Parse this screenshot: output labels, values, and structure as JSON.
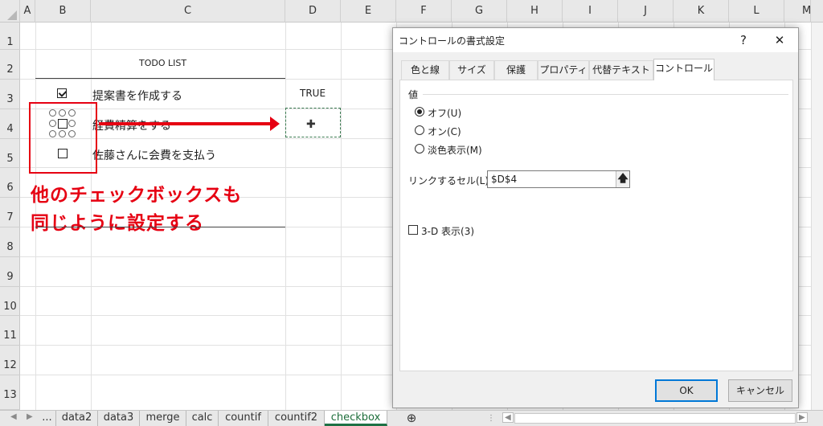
{
  "sheet": {
    "columns": [
      "A",
      "B",
      "C",
      "D",
      "E",
      "F",
      "G",
      "H",
      "I",
      "J",
      "K",
      "L",
      "M"
    ],
    "rows": [
      "1",
      "2",
      "3",
      "4",
      "5",
      "6",
      "7",
      "8",
      "9",
      "10",
      "11",
      "12",
      "13"
    ]
  },
  "todo": {
    "title": "TODO LIST",
    "items": [
      {
        "label": "提案書を作成する",
        "checked": true
      },
      {
        "label": "経費精算をする",
        "checked": false
      },
      {
        "label": "佐藤さんに会費を支払う",
        "checked": false
      }
    ],
    "linked_value": "TRUE"
  },
  "annotation": {
    "lines": [
      "他のチェックボックスも",
      "同じように設定する"
    ],
    "color": "#e60012"
  },
  "dialog": {
    "title": "コントロールの書式設定",
    "help": "?",
    "close": "✕",
    "tabs": [
      "色と線",
      "サイズ",
      "保護",
      "プロパティ",
      "代替テキスト",
      "コントロール"
    ],
    "active_tab": "コントロール",
    "group_label": "値",
    "radios": [
      {
        "label": "オフ(U)",
        "selected": true
      },
      {
        "label": "オン(C)",
        "selected": false
      },
      {
        "label": "淡色表示(M)",
        "selected": false
      }
    ],
    "link_label": "リンクするセル(L):",
    "link_value": "$D$4",
    "shading_label": "3-D 表示(3)",
    "shading_checked": false,
    "ok": "OK",
    "cancel": "キャンセル"
  },
  "sheet_tabs": {
    "more": "...",
    "items": [
      "data2",
      "data3",
      "merge",
      "calc",
      "countif",
      "countif2",
      "checkbox"
    ],
    "active": "checkbox",
    "add": "⊕"
  },
  "colors": {
    "accent_green": "#1e7145",
    "dialog_ok_border": "#0078d7"
  }
}
